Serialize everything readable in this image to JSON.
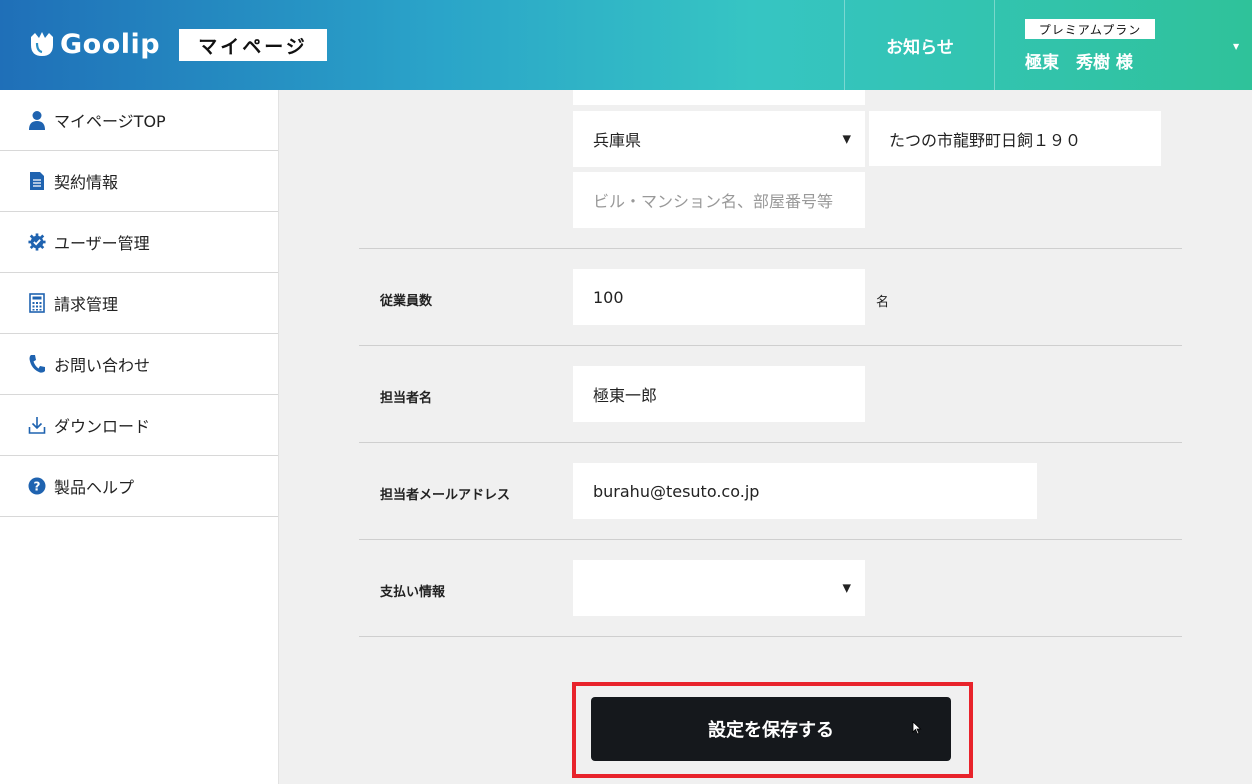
{
  "header": {
    "logo_text": "Goolip",
    "mypage_label": "マイページ",
    "notice_label": "お知らせ",
    "plan_label": "プレミアムプラン",
    "user_name": "極東　秀樹 様"
  },
  "sidebar": {
    "items": [
      {
        "label": "マイページTOP",
        "icon": "user-icon"
      },
      {
        "label": "契約情報",
        "icon": "document-icon"
      },
      {
        "label": "ユーザー管理",
        "icon": "gear-check-icon"
      },
      {
        "label": "請求管理",
        "icon": "calculator-icon"
      },
      {
        "label": "お問い合わせ",
        "icon": "phone-icon"
      },
      {
        "label": "ダウンロード",
        "icon": "download-icon"
      },
      {
        "label": "製品ヘルプ",
        "icon": "help-icon"
      }
    ]
  },
  "form": {
    "prefecture_value": "兵庫県",
    "address_value": "たつの市龍野町日飼１９０",
    "building_placeholder": "ビル・マンション名、部屋番号等",
    "employees_label": "従業員数",
    "employees_value": "100",
    "employees_unit": "名",
    "contact_name_label": "担当者名",
    "contact_name_value": "極東一郎",
    "contact_email_label": "担当者メールアドレス",
    "contact_email_value": "burahu@tesuto.co.jp",
    "payment_label": "支払い情報",
    "payment_value": "",
    "save_label": "設定を保存する"
  },
  "colors": {
    "header_start": "#1f6fb8",
    "header_end": "#2fc29a",
    "icon_blue": "#1f63b0",
    "save_button": "#15181c",
    "highlight": "#e8232b"
  }
}
